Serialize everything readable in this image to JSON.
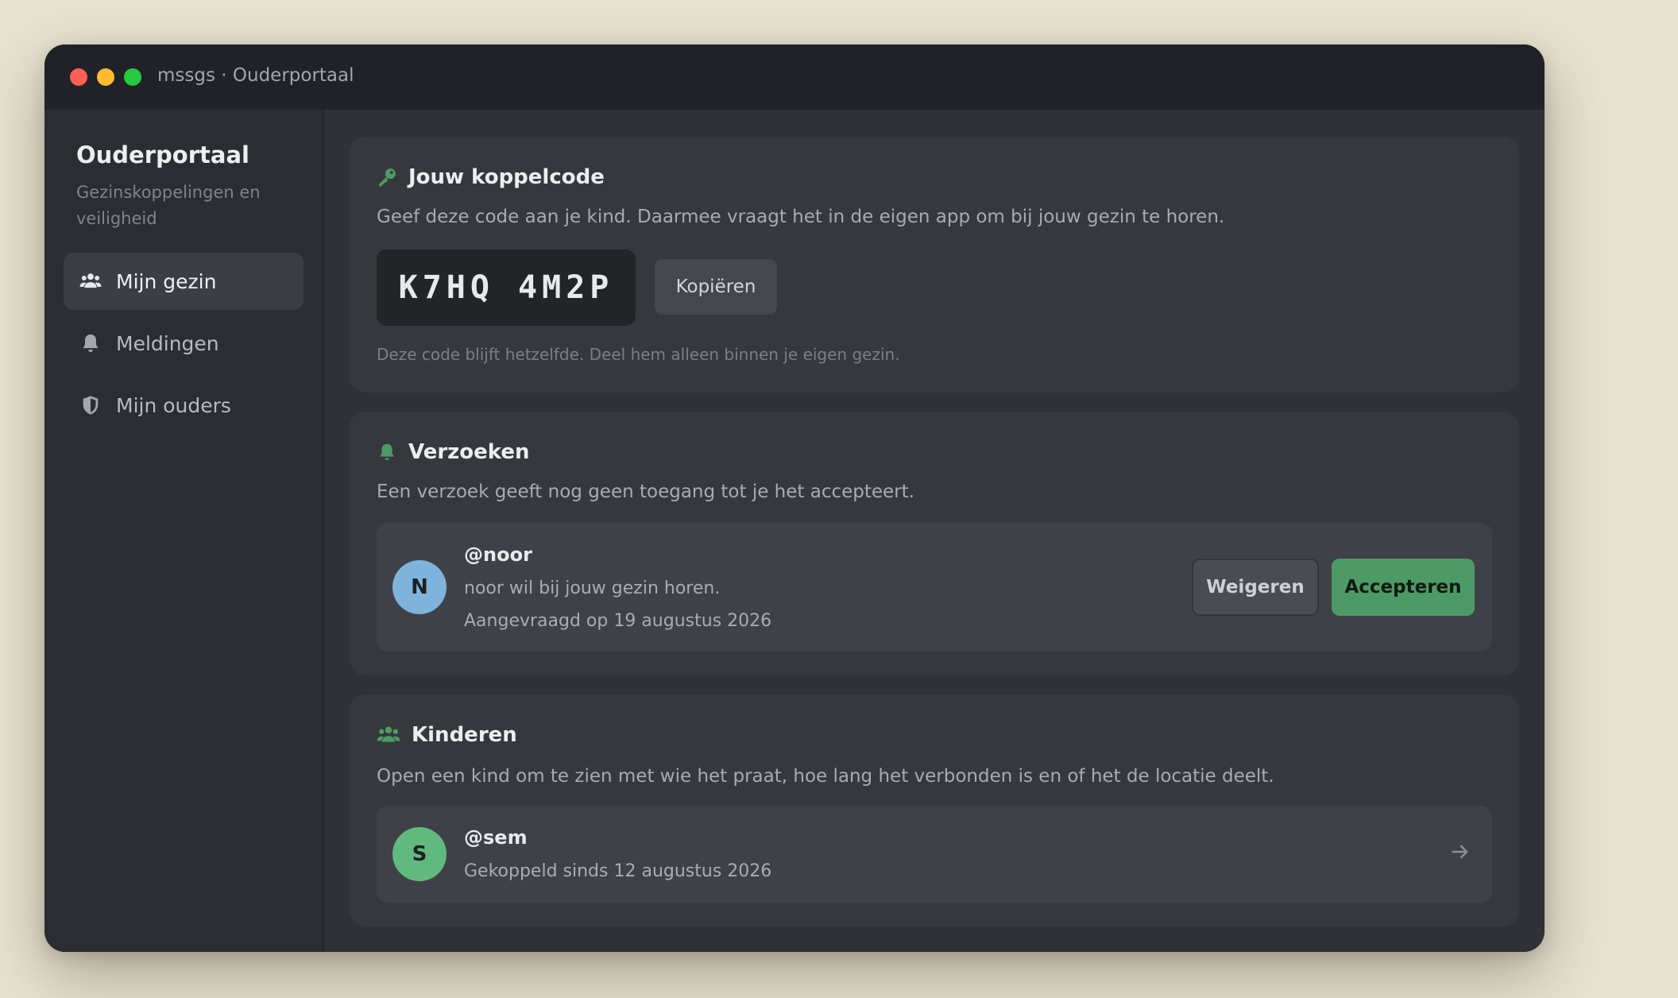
{
  "window": {
    "title": "mssgs · Ouderportaal"
  },
  "colors": {
    "accent": "#4e9a66",
    "avatar_noor": "#7fb3dc",
    "avatar_sem": "#62b97f"
  },
  "sidebar": {
    "title": "Ouderportaal",
    "subtitle": "Gezinskoppelingen en veiligheid",
    "items": [
      {
        "label": "Mijn gezin",
        "icon": "users-icon",
        "active": true
      },
      {
        "label": "Meldingen",
        "icon": "bell-icon",
        "active": false
      },
      {
        "label": "Mijn ouders",
        "icon": "shield-icon",
        "active": false
      }
    ]
  },
  "code_card": {
    "title": "Jouw koppelcode",
    "icon": "key-icon",
    "description": "Geef deze code aan je kind. Daarmee vraagt het in de eigen app om bij jouw gezin te horen.",
    "code": "K7HQ 4M2P",
    "copy_label": "Kopiëren",
    "note": "Deze code blijft hetzelfde. Deel hem alleen binnen je eigen gezin."
  },
  "requests_card": {
    "title": "Verzoeken",
    "icon": "bell-icon",
    "description": "Een verzoek geeft nog geen toegang tot je het accepteert.",
    "requests": [
      {
        "initial": "N",
        "username": "@noor",
        "message": "noor wil bij jouw gezin horen.",
        "requested": "Aangevraagd op 19 augustus 2026",
        "reject_label": "Weigeren",
        "accept_label": "Accepteren"
      }
    ]
  },
  "children_card": {
    "title": "Kinderen",
    "icon": "users-icon",
    "description": "Open een kind om te zien met wie het praat, hoe lang het verbonden is en of het de locatie deelt.",
    "children": [
      {
        "initial": "S",
        "username": "@sem",
        "linked": "Gekoppeld sinds 12 augustus 2026",
        "icon": "arrow-right-icon"
      }
    ]
  }
}
